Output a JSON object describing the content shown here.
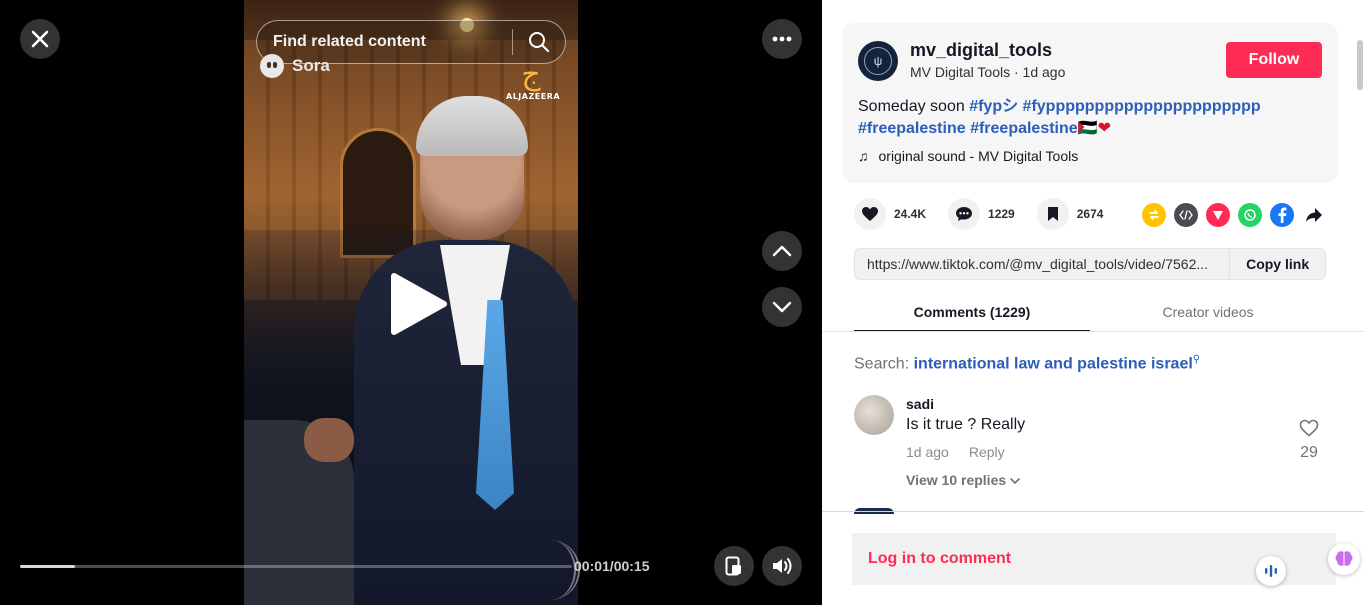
{
  "video": {
    "search_placeholder": "Find related content",
    "watermark": "Sora",
    "broadcaster_logo_text": "ALJAZEERA",
    "time": "00:01/00:15",
    "progress": 0.1
  },
  "post": {
    "username": "mv_digital_tools",
    "display_meta": "MV Digital Tools · 1d ago",
    "follow_label": "Follow",
    "caption_text": "Someday soon ",
    "hashtags": [
      "#fypシ",
      "#fypppppppppppppppppppppp",
      "#freepalestine",
      "#freepalestine🇵🇸"
    ],
    "sound": "original sound - MV Digital Tools",
    "avatar_text": "MV Digital Tools"
  },
  "stats": {
    "likes": "24.4K",
    "comments": "1229",
    "saves": "2674"
  },
  "share": {
    "url": "https://www.tiktok.com/@mv_digital_tools/video/7562...",
    "copy_label": "Copy link",
    "icons": [
      "repost-icon",
      "embed-icon",
      "send-icon",
      "whatsapp-icon",
      "facebook-icon",
      "share-arrow-icon"
    ],
    "colors": {
      "repost": "#ffc300",
      "embed": "#4b4b52",
      "send": "#fe2c55",
      "whatsapp": "#25d366",
      "facebook": "#1877f2"
    }
  },
  "tabs": [
    {
      "label": "Comments (1229)",
      "active": true
    },
    {
      "label": "Creator videos",
      "active": false
    }
  ],
  "comment_search": {
    "prefix": "Search:",
    "term": "international law and palestine israel"
  },
  "comments": [
    {
      "user": "sadi",
      "text": "Is it true ? Really",
      "time": "1d ago",
      "reply_label": "Reply",
      "likes": "29",
      "view_replies": "View 10 replies"
    }
  ],
  "footer": {
    "login_label": "Log in to comment"
  },
  "colors": {
    "accent": "#fe2c55",
    "hashtag": "#2b5db9"
  }
}
